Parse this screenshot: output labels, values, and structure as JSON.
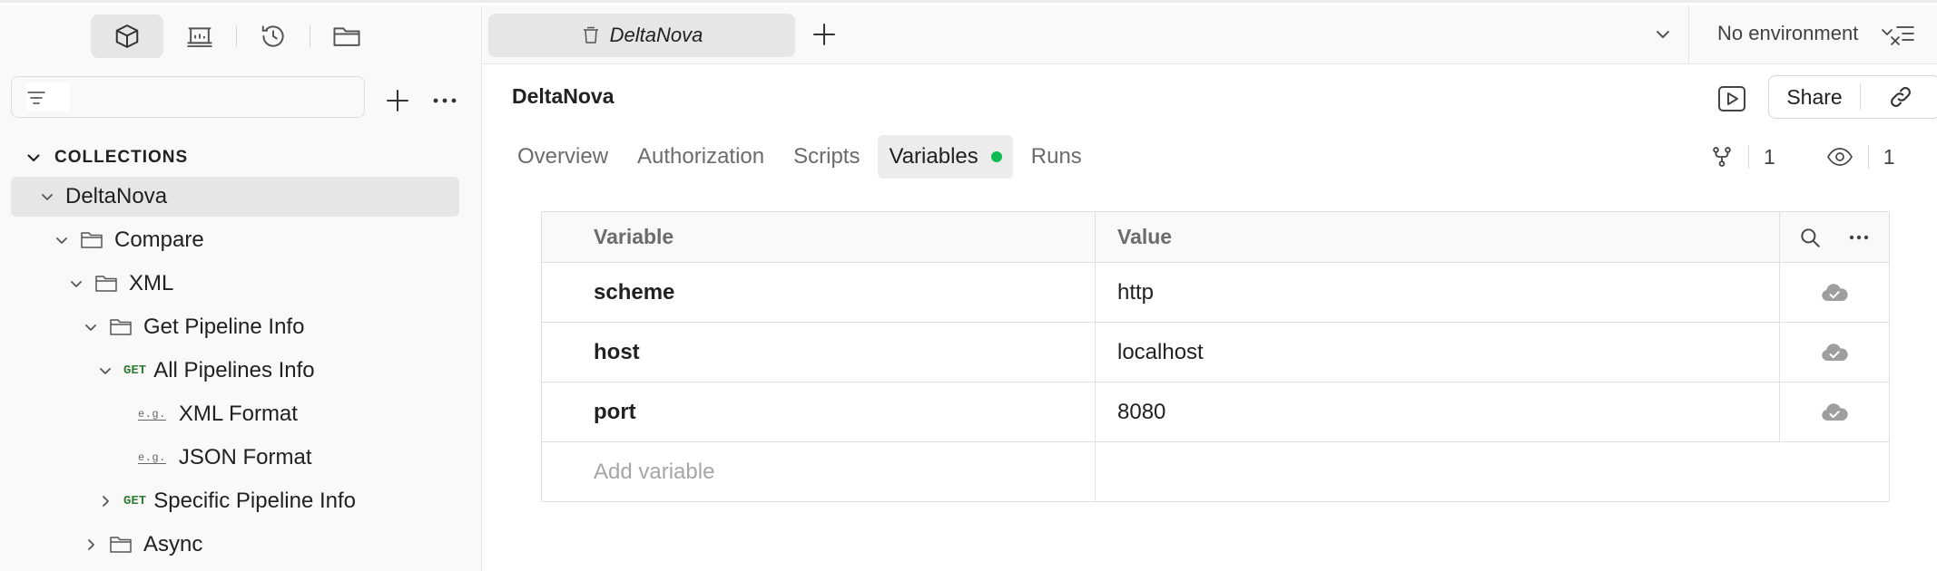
{
  "sidebar": {
    "filter_placeholder": "",
    "section_label": "COLLECTIONS",
    "tree": [
      {
        "label": "DeltaNova",
        "type": "collection",
        "expanded": true,
        "selected": true
      },
      {
        "label": "Compare",
        "type": "folder",
        "expanded": true
      },
      {
        "label": "XML",
        "type": "folder",
        "expanded": true
      },
      {
        "label": "Get Pipeline Info",
        "type": "folder",
        "expanded": true
      },
      {
        "label": "All Pipelines Info",
        "type": "request",
        "method": "GET",
        "expanded": true
      },
      {
        "label": "XML Format",
        "type": "example",
        "badge": "e.g."
      },
      {
        "label": "JSON Format",
        "type": "example",
        "badge": "e.g."
      },
      {
        "label": "Specific Pipeline Info",
        "type": "request",
        "method": "GET",
        "expanded": false
      },
      {
        "label": "Async",
        "type": "folder",
        "expanded": false
      }
    ]
  },
  "tabbar": {
    "tab_label": "DeltaNova",
    "environment": "No environment"
  },
  "main": {
    "title": "DeltaNova",
    "share_label": "Share",
    "tabs": [
      "Overview",
      "Authorization",
      "Scripts",
      "Variables",
      "Runs"
    ],
    "active_tab": "Variables",
    "forks_count": "1",
    "watchers_count": "1",
    "table": {
      "headers": [
        "Variable",
        "Value"
      ],
      "rows": [
        {
          "name": "scheme",
          "value": "http"
        },
        {
          "name": "host",
          "value": "localhost"
        },
        {
          "name": "port",
          "value": "8080"
        }
      ],
      "add_placeholder": "Add variable"
    }
  },
  "colors": {
    "accent_green": "#0cbb52",
    "get_method": "#2e7d32",
    "selected_bg": "#e6e6e6"
  }
}
